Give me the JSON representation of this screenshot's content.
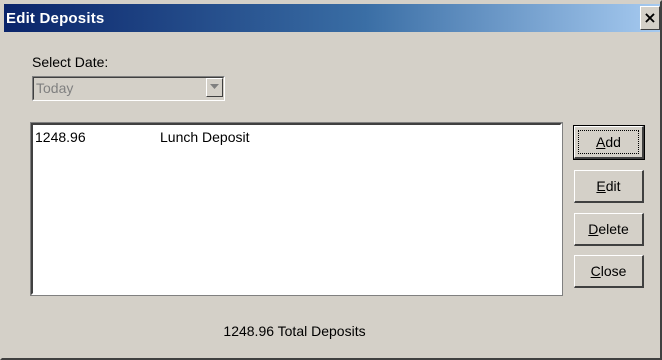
{
  "window": {
    "title": "Edit Deposits",
    "close_glyph": "×"
  },
  "date_filter": {
    "label": "Select Date:",
    "selected": "Today"
  },
  "deposits": [
    {
      "amount": "1248.96",
      "description": "Lunch Deposit"
    }
  ],
  "buttons": {
    "add": {
      "mnemonic": "A",
      "rest": "dd"
    },
    "edit": {
      "mnemonic": "E",
      "rest": "dit"
    },
    "delete": {
      "mnemonic": "D",
      "rest": "elete"
    },
    "close": {
      "mnemonic": "C",
      "rest": "lose"
    }
  },
  "footer": {
    "total_text": "1248.96 Total Deposits"
  },
  "colors": {
    "title_gradient_start": "#0a246a",
    "title_gradient_end": "#a6caf0",
    "face": "#d4d0c8"
  }
}
